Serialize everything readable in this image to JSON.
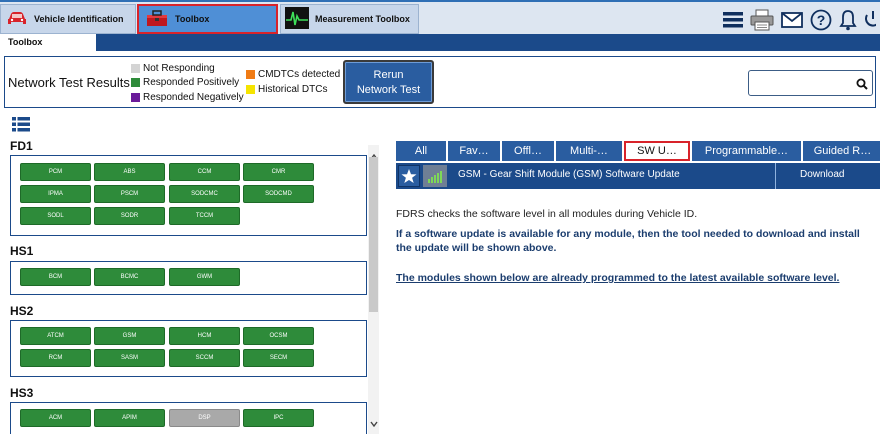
{
  "top_tabs": [
    {
      "label": "Vehicle Identification",
      "icon": "car-icon"
    },
    {
      "label": "Toolbox",
      "icon": "toolbox-icon",
      "active": true
    },
    {
      "label": "Measurement Toolbox",
      "icon": "oscilloscope-icon"
    }
  ],
  "top_icons": [
    "menu-icon",
    "printer-icon",
    "mail-icon",
    "help-icon",
    "bell-icon",
    "power-icon"
  ],
  "sub_tab": "Toolbox",
  "network_test": {
    "title": "Network Test Results",
    "legend": [
      {
        "label": "Not Responding",
        "color": "#d4d4d4"
      },
      {
        "label": "Responded Positively",
        "color": "#2e8b3a"
      },
      {
        "label": "Responded Negatively",
        "color": "#6a1b9a"
      },
      {
        "label": "CMDTCs detected",
        "color": "#f07b14"
      },
      {
        "label": "Historical DTCs",
        "color": "#f5e400"
      }
    ],
    "rerun_line1": "Rerun",
    "rerun_line2": "Network Test",
    "search_value": ""
  },
  "module_groups": [
    {
      "name": "FD1",
      "modules": [
        {
          "label": "PCM",
          "status": "positive"
        },
        {
          "label": "ABS",
          "status": "positive"
        },
        {
          "label": "CCM",
          "status": "positive"
        },
        {
          "label": "CMR",
          "status": "positive"
        },
        {
          "label": "IPMA",
          "status": "positive"
        },
        {
          "label": "PSCM",
          "status": "positive"
        },
        {
          "label": "SODCMC",
          "status": "positive"
        },
        {
          "label": "SODCMD",
          "status": "positive"
        },
        {
          "label": "SODL",
          "status": "positive"
        },
        {
          "label": "SODR",
          "status": "positive"
        },
        {
          "label": "TCCM",
          "status": "positive"
        }
      ]
    },
    {
      "name": "HS1",
      "modules": [
        {
          "label": "BCM",
          "status": "positive"
        },
        {
          "label": "BCMC",
          "status": "positive"
        },
        {
          "label": "GWM",
          "status": "positive"
        }
      ]
    },
    {
      "name": "HS2",
      "modules": [
        {
          "label": "ATCM",
          "status": "positive"
        },
        {
          "label": "GSM",
          "status": "positive"
        },
        {
          "label": "HCM",
          "status": "positive"
        },
        {
          "label": "OCSM",
          "status": "positive"
        },
        {
          "label": "RCM",
          "status": "positive"
        },
        {
          "label": "SASM",
          "status": "positive"
        },
        {
          "label": "SCCM",
          "status": "positive"
        },
        {
          "label": "SECM",
          "status": "positive"
        }
      ]
    },
    {
      "name": "HS3",
      "modules": [
        {
          "label": "ACM",
          "status": "positive"
        },
        {
          "label": "APIM",
          "status": "positive"
        },
        {
          "label": "DSP",
          "status": "not-responding"
        },
        {
          "label": "IPC",
          "status": "positive"
        }
      ]
    }
  ],
  "filter_tabs": [
    {
      "label": "All"
    },
    {
      "label": "Fav…"
    },
    {
      "label": "Offl…"
    },
    {
      "label": "Multi-…"
    },
    {
      "label": "SW U…",
      "active": true
    },
    {
      "label": "Programmable…"
    },
    {
      "label": "Guided R…"
    }
  ],
  "sw_update": {
    "name": "GSM - Gear Shift Module (GSM) Software Update",
    "action": "Download"
  },
  "messages": {
    "check": "FDRS checks the software level in all modules during Vehicle ID.",
    "update_line1": "If a software update is available for any module, then the tool needed to download and install",
    "update_line2": "the update will be shown above.",
    "latest": "The modules shown below are already programmed to the latest available software level."
  }
}
